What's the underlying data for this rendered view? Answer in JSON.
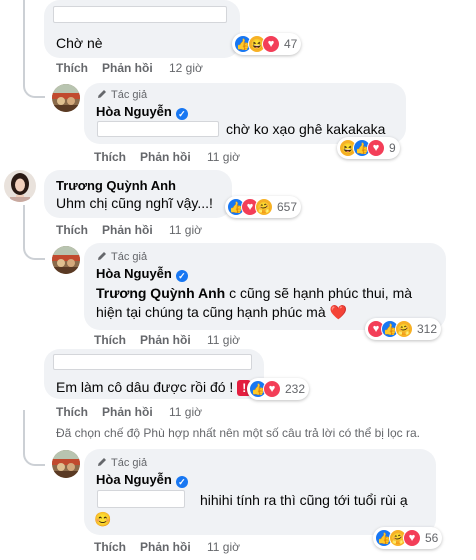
{
  "labels": {
    "like": "Thích",
    "reply": "Phản hồi",
    "author_badge": "Tác giả"
  },
  "comments": [
    {
      "text": "Chờ nè",
      "time": "12 giờ",
      "reaction_count": "47"
    },
    {
      "author": "Hòa Nguyễn",
      "text": "chờ ko xạo ghê kakakaka",
      "time": "11 giờ",
      "reaction_count": "9"
    },
    {
      "author": "Trương Quỳnh Anh",
      "text": "Uhm chị cũng nghĩ vậy...!",
      "time": "11 giờ",
      "reaction_count": "657"
    },
    {
      "author": "Hòa Nguyễn",
      "mention": "Trương Quỳnh Anh",
      "text1": " c cũng sẽ hạnh phúc thui, mà",
      "text2": "hiện tại chúng ta cũng hạnh phúc mà ",
      "heart": "❤️",
      "time": "11 giờ",
      "reaction_count": "312"
    },
    {
      "text": "Em làm cô dâu được rồi đó ! ",
      "time": "11 giờ",
      "reaction_count": "232"
    },
    {
      "author": "Hòa Nguyễn",
      "text": "hihihi tính ra thì cũng tới tuổi rùi ạ",
      "emoji": "😊",
      "time": "11 giờ",
      "reaction_count": "56"
    }
  ],
  "filter_notice": "Đã chọn chế độ Phù hợp nhất nên một số câu trả lời có thể bị lọc ra.",
  "colors": {
    "like": "#1877f2",
    "love": "#f33e58",
    "haha": "#f7b125",
    "verified": "#1877f2",
    "secondary_text": "#65676b"
  }
}
